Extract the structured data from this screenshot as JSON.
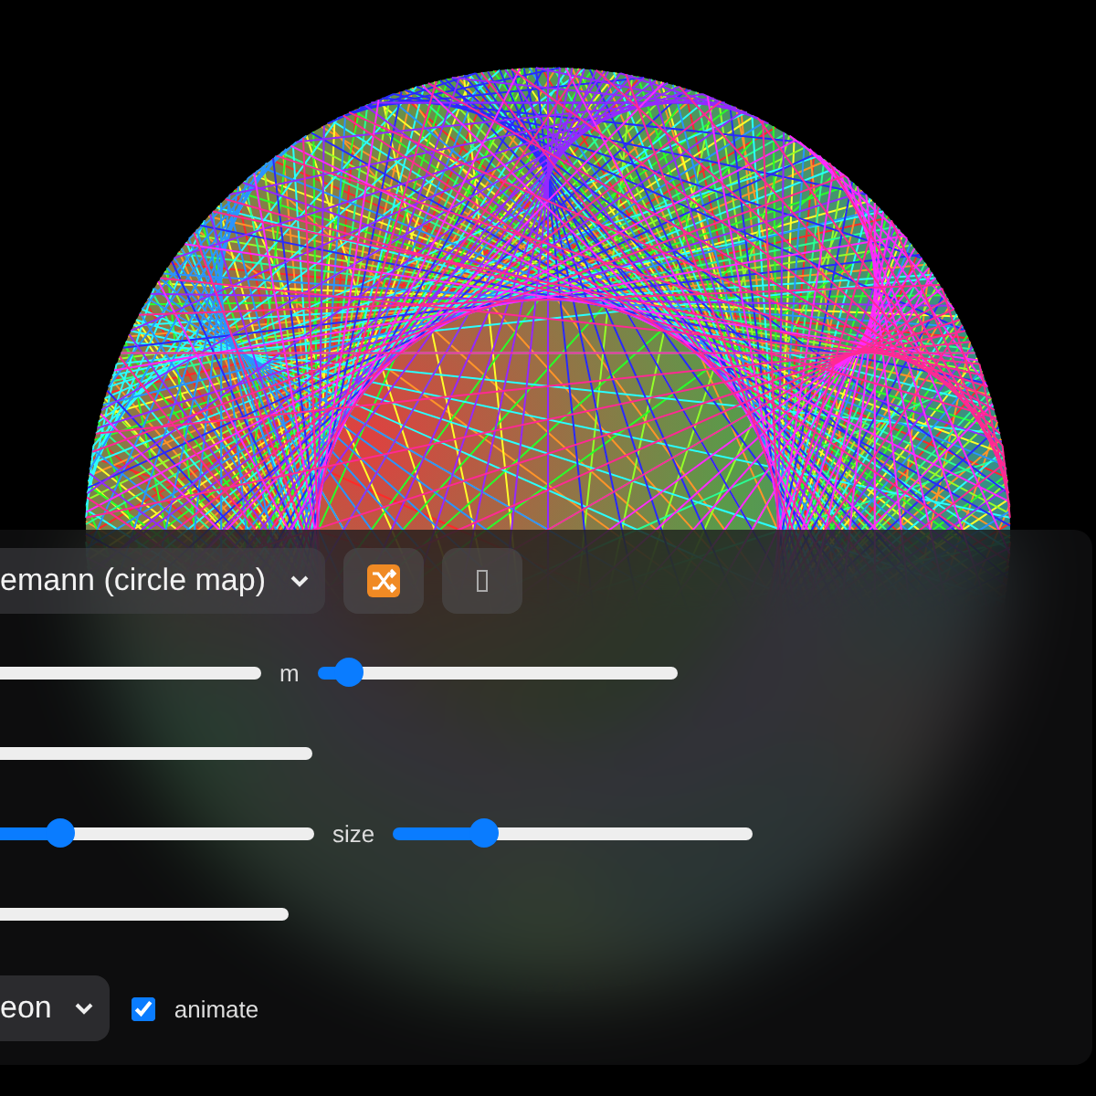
{
  "controls": {
    "top_row": {
      "preset_select": {
        "value": "emann (circle map)"
      },
      "buttons": [
        {
          "kind": "shuffle"
        },
        {
          "kind": "missing-glyph"
        }
      ]
    },
    "slider_rows": [
      {
        "sliders": [
          {
            "level": 0.0
          },
          {
            "label": "m",
            "level": 0.05
          }
        ]
      },
      {
        "sliders": [
          {
            "level": 0.0
          }
        ]
      },
      {
        "sliders": [
          {
            "level": 0.33
          },
          {
            "label": "size",
            "level": 0.23
          }
        ]
      },
      {
        "sliders": [
          {
            "level": 0.0
          }
        ]
      }
    ],
    "bottom_row": {
      "palette_select": {
        "value": "eon"
      },
      "animate": {
        "label": "animate",
        "checked": true
      }
    }
  }
}
